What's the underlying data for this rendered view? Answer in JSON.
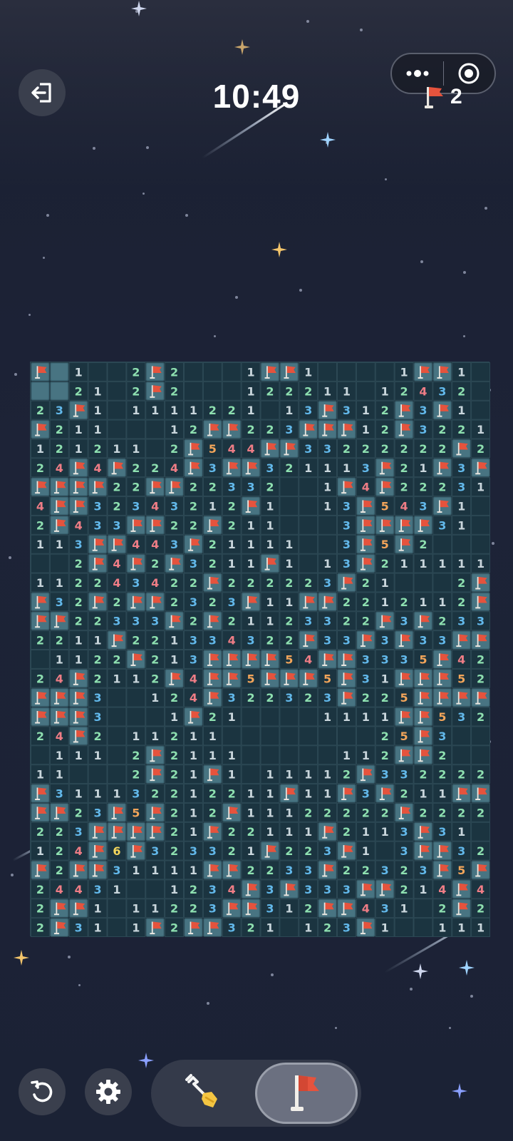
{
  "header": {
    "exit_icon": "exit-icon",
    "timer": "10:49",
    "menu_icon": "more-dots-icon",
    "close_icon": "target-circle-icon",
    "flags_remaining": "2",
    "flag_icon": "flag-icon"
  },
  "board": {
    "columns": 24,
    "rows": 30,
    "cells": [
      "F,C,1,0,0,2,F,2,0,0,0,1,F,F,1,0,0,0,0,1,F,F,1,0",
      "C,C,2,1,0,2,F,2,0,0,0,1,2,2,2,1,1,0,1,2,4,3,2,0",
      "2,3,F,1,0,1,1,1,1,2,2,1,0,1,3,F,3,1,2,F,3,F,1,0",
      "F,2,1,1,0,0,0,1,2,F,F,2,2,3,F,F,F,1,2,F,3,2,2,1",
      "1,2,1,2,1,1,0,2,F,5,4,4,F,F,3,3,2,2,2,2,2,2,F,2",
      "2,4,F,4,F,2,2,4,F,3,F,F,3,2,1,1,1,3,F,2,1,F,3,F",
      "F,F,F,F,2,2,F,F,2,2,3,3,2,0,0,1,F,4,F,2,2,2,3,1",
      "4,F,F,3,2,3,4,3,2,1,2,F,1,0,0,1,3,F,5,4,3,F,1,0",
      "2,F,4,3,3,F,F,2,2,F,2,1,1,0,0,0,3,F,F,F,F,3,1,0",
      "1,1,3,F,F,4,4,3,F,2,1,1,1,1,0,0,3,F,5,F,2,0,0,0",
      "0,0,2,F,4,F,2,F,3,2,1,1,F,1,0,1,3,F,2,1,1,1,1,1",
      "1,1,2,2,4,3,4,2,2,F,2,2,2,2,2,3,F,2,1,0,0,0,2,F",
      "F,3,2,F,2,F,F,2,3,2,3,F,1,1,F,F,2,2,1,2,1,1,2,F",
      "F,F,2,2,3,3,3,F,2,F,2,1,1,2,3,3,2,2,F,3,F,2,3,3",
      "2,2,1,1,F,2,2,1,3,3,4,3,2,2,F,3,3,F,3,F,3,3,F,F",
      "0,1,1,2,2,F,2,1,3,F,F,F,F,5,4,F,F,3,3,3,5,F,4,2",
      "2,4,F,2,1,1,2,F,4,F,F,5,F,F,F,5,F,3,1,F,F,F,5,2",
      "F,F,F,3,0,0,1,2,4,F,3,2,2,3,2,3,F,2,2,5,F,F,F,F",
      "F,F,F,3,0,0,0,1,F,2,1,0,0,0,0,1,1,1,1,F,F,5,3,2",
      "2,4,F,2,0,1,1,2,1,1,0,0,0,0,0,0,0,0,2,5,F,3,0,0",
      "0,1,1,1,0,2,F,2,1,1,1,0,0,0,0,0,1,1,2,F,F,2,0,0",
      "1,1,0,0,0,2,F,2,1,F,1,0,1,1,1,1,2,F,3,3,2,2,2,2",
      "F,3,1,1,1,3,2,2,1,2,2,1,1,F,1,1,F,3,F,2,1,1,F,F",
      "F,F,2,3,F,5,F,2,1,2,F,1,1,1,2,2,2,2,2,F,2,2,2,2",
      "2,2,3,F,F,F,F,2,1,F,2,2,1,1,1,F,2,1,1,3,F,3,1,0",
      "1,2,4,F,6,F,3,2,3,3,2,1,F,2,2,3,F,1,0,3,F,F,3,2",
      "F,2,F,F,3,1,1,1,1,F,F,2,2,3,3,F,2,2,3,2,3,F,5,F,F",
      "2,4,4,3,1,0,0,1,2,3,4,F,3,F,3,3,3,F,F,2,1,4,F,4",
      "2,F,F,1,0,1,1,2,2,3,F,F,3,1,2,F,F,4,3,1,0,2,F,2",
      "2,F,3,1,0,1,F,2,F,F,3,2,1,0,1,2,3,F,1,0,0,1,1,1"
    ]
  },
  "controls": {
    "restart_icon": "restart-icon",
    "settings_icon": "gear-icon",
    "dig_mode_icon": "shovel-icon",
    "flag_mode_icon": "flag-icon",
    "active_mode": "flag"
  },
  "colors": {
    "n1": "#c9d6dc",
    "n2": "#8ee0b0",
    "n3": "#62b8ea",
    "n4": "#ef7d86",
    "n5": "#f2a55a",
    "n6": "#f3d65c",
    "flag": "#e5533d",
    "cell_border": "#2c4854",
    "covered": "#3f6a78"
  }
}
